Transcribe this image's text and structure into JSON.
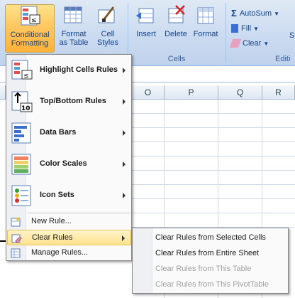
{
  "ribbon": {
    "conditional_formatting": "Conditional Formatting",
    "format_as_table": "Format as Table",
    "cell_styles": "Cell Styles",
    "insert": "Insert",
    "delete": "Delete",
    "format": "Format",
    "cells_group": "Cells",
    "autosum": "AutoSum",
    "fill": "Fill",
    "clear": "Clear",
    "editing_group": "Editi",
    "partial_button": "S"
  },
  "columns": [
    "O",
    "P",
    "Q",
    "R"
  ],
  "menu": {
    "items": [
      {
        "label": "Highlight Cells Rules",
        "icon": "highlight-cells-icon"
      },
      {
        "label": "Top/Bottom Rules",
        "icon": "top-bottom-icon"
      },
      {
        "label": "Data Bars",
        "icon": "data-bars-icon"
      },
      {
        "label": "Color Scales",
        "icon": "color-scales-icon"
      },
      {
        "label": "Icon Sets",
        "icon": "icon-sets-icon"
      }
    ],
    "new_rule": "New Rule...",
    "clear_rules": "Clear Rules",
    "manage_rules": "Manage Rules..."
  },
  "submenu": {
    "items": [
      {
        "label": "Clear Rules from Selected Cells",
        "enabled": true
      },
      {
        "label": "Clear Rules from Entire Sheet",
        "enabled": true
      },
      {
        "label": "Clear Rules from This Table",
        "enabled": false
      },
      {
        "label": "Clear Rules from This PivotTable",
        "enabled": false
      }
    ]
  }
}
